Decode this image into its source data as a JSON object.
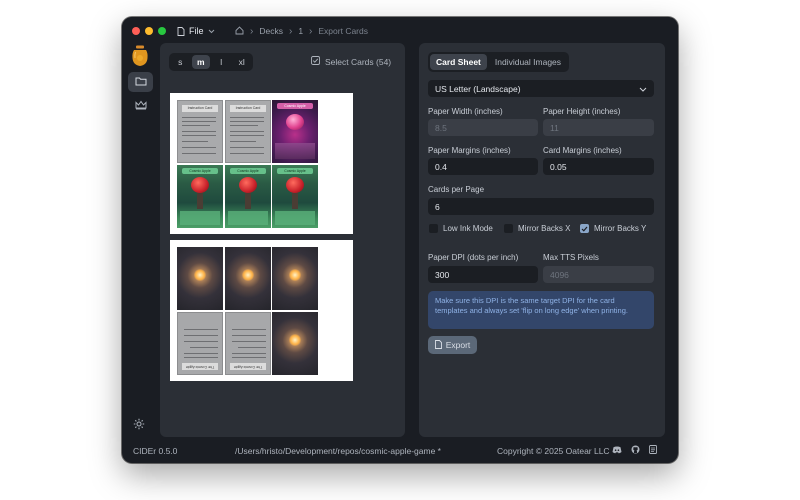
{
  "menu": {
    "file_label": "File"
  },
  "breadcrumb": {
    "home_icon": "home-icon",
    "decks": "Decks",
    "deck_id": "1",
    "current": "Export Cards"
  },
  "sidebar": {
    "items": [
      {
        "icon": "folder-icon",
        "active": true
      },
      {
        "icon": "crown-icon",
        "active": false
      }
    ],
    "settings_icon": "gear-icon"
  },
  "preview": {
    "sizes": [
      "s",
      "m",
      "l",
      "xl"
    ],
    "selected_size": "m",
    "select_cards_label": "Select Cards (54)",
    "sheet1_cards": [
      {
        "type": "instruction",
        "title": "Instruction Card"
      },
      {
        "type": "instruction",
        "title": "Instruction Card"
      },
      {
        "type": "purple-apple",
        "title": "Cosmic Apple"
      },
      {
        "type": "green-apple",
        "title": "Cosmic Apple"
      },
      {
        "type": "green-apple",
        "title": "Cosmic Apple"
      },
      {
        "type": "green-apple",
        "title": "Cosmic Apple"
      }
    ],
    "sheet2_cards": [
      {
        "type": "cosmic-back"
      },
      {
        "type": "cosmic-back"
      },
      {
        "type": "cosmic-back"
      },
      {
        "type": "instruction-back",
        "title": "The Cosmic Apple"
      },
      {
        "type": "instruction-back",
        "title": "The Cosmic Apple"
      },
      {
        "type": "cosmic-back"
      }
    ]
  },
  "export": {
    "tabs": [
      "Card Sheet",
      "Individual Images"
    ],
    "active_tab": "Card Sheet",
    "paper_size": "US Letter (Landscape)",
    "paper_width_label": "Paper Width (inches)",
    "paper_width_value": "8.5",
    "paper_height_label": "Paper Height (inches)",
    "paper_height_value": "11",
    "paper_margins_label": "Paper Margins (inches)",
    "paper_margins_value": "0.4",
    "card_margins_label": "Card Margins (inches)",
    "card_margins_value": "0.05",
    "cards_per_page_label": "Cards per Page",
    "cards_per_page_value": "6",
    "low_ink_label": "Low Ink Mode",
    "low_ink_checked": false,
    "mirror_x_label": "Mirror Backs X",
    "mirror_x_checked": false,
    "mirror_y_label": "Mirror Backs Y",
    "mirror_y_checked": true,
    "dpi_label": "Paper DPI (dots per inch)",
    "dpi_value": "300",
    "max_tts_label": "Max TTS Pixels",
    "max_tts_value": "4096",
    "info_text": "Make sure this DPI is the same target DPI for the card templates and always set 'flip on long edge' when printing.",
    "export_button": "Export"
  },
  "status": {
    "version": "CIDEr 0.5.0",
    "path": "/Users/hristo/Development/repos/cosmic-apple-game *",
    "copyright": "Copyright © 2025 Oatear LLC"
  },
  "colors": {
    "window_bg": "#1a1d23",
    "panel_bg": "#2b2f36",
    "info_bg": "#33466a",
    "info_text": "#8fb2e6",
    "accent_check": "#8aa6c8"
  }
}
